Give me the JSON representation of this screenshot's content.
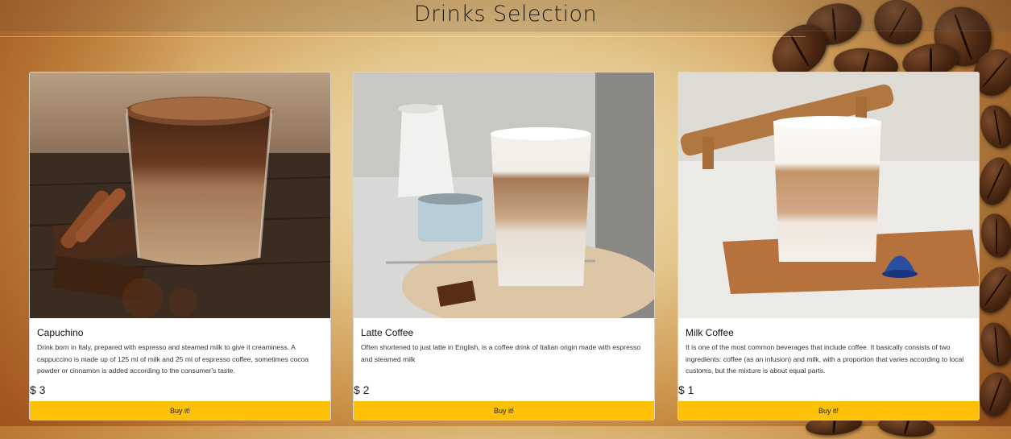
{
  "header": {
    "title": "Drinks Selection"
  },
  "cards": [
    {
      "title": "Capuchino",
      "description": "Drink born in Italy, prepared with espresso and steamed milk to give it creaminess. A cappuccino is made up of 125 ml of milk and 25 ml of espresso coffee, sometimes cocoa powder or cinnamon is added according to the consumer's taste.",
      "price": "$ 3",
      "button": "Buy it!",
      "image_icon": "cappuccino-image"
    },
    {
      "title": "Latte Coffee",
      "description": "Often shortened to just latte in English, is a coffee drink of Italian origin made with espresso and steamed milk",
      "price": "$ 2",
      "button": "Buy it!",
      "image_icon": "latte-image"
    },
    {
      "title": "Milk Coffee",
      "description": "It is one of the most common beverages that include coffee. It basically consists of two ingredients: coffee (as an infusion) and milk, with a proportion that varies according to local customs, but the mixture is about equal parts.",
      "price": "$ 1",
      "button": "Buy it!",
      "image_icon": "milk-coffee-image"
    }
  ],
  "colors": {
    "button": "#ffc107",
    "card_bg": "#ffffff"
  }
}
